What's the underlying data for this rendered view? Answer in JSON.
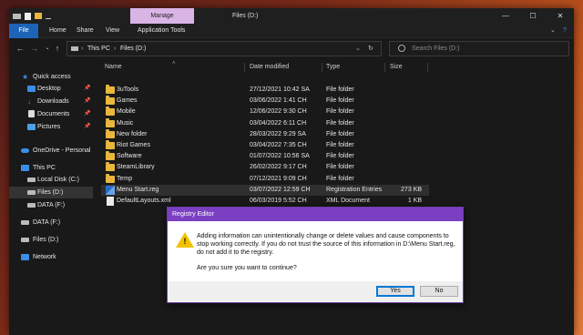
{
  "window": {
    "title": "Files (D:)",
    "manage_tab": "Manage",
    "controls": {
      "minimize": "—",
      "maximize": "☐",
      "close": "✕"
    }
  },
  "ribbon": {
    "tabs": [
      "File",
      "Home",
      "Share",
      "View",
      "Application Tools"
    ]
  },
  "address": {
    "path": [
      "This PC",
      "Files (D:)"
    ],
    "separator": "›",
    "search_placeholder": "Search Files (D:)"
  },
  "nav": {
    "items": [
      {
        "label": "Quick access",
        "icon": "star-icon",
        "pinned": false
      },
      {
        "label": "Desktop",
        "icon": "desktop-icon",
        "pinned": true
      },
      {
        "label": "Downloads",
        "icon": "download-icon",
        "pinned": true
      },
      {
        "label": "Documents",
        "icon": "documents-icon",
        "pinned": true
      },
      {
        "label": "Pictures",
        "icon": "pictures-icon",
        "pinned": true
      },
      {
        "label": "OneDrive - Personal",
        "icon": "cloud-icon",
        "pinned": false
      },
      {
        "label": "This PC",
        "icon": "computer-icon",
        "pinned": false
      },
      {
        "label": "Local Disk (C:)",
        "icon": "drive-icon",
        "pinned": false
      },
      {
        "label": "Files (D:)",
        "icon": "drive-icon",
        "pinned": false
      },
      {
        "label": "DATA (F:)",
        "icon": "drive-icon",
        "pinned": false
      },
      {
        "label": "DATA (F:)",
        "icon": "drive-icon",
        "pinned": false
      },
      {
        "label": "Files (D:)",
        "icon": "drive-icon",
        "pinned": false
      },
      {
        "label": "Network",
        "icon": "network-icon",
        "pinned": false
      }
    ]
  },
  "list": {
    "columns": [
      "Name",
      "Date modified",
      "Type",
      "Size"
    ],
    "rows": [
      {
        "name": "3uTools",
        "date": "27/12/2021 10:42 SA",
        "type": "File folder",
        "size": "",
        "icon": "folder"
      },
      {
        "name": "Games",
        "date": "03/06/2022 1:41 CH",
        "type": "File folder",
        "size": "",
        "icon": "folder"
      },
      {
        "name": "Mobile",
        "date": "12/06/2022 9:30 CH",
        "type": "File folder",
        "size": "",
        "icon": "folder"
      },
      {
        "name": "Music",
        "date": "03/04/2022 6:11 CH",
        "type": "File folder",
        "size": "",
        "icon": "folder"
      },
      {
        "name": "New folder",
        "date": "28/03/2022 9:29 SA",
        "type": "File folder",
        "size": "",
        "icon": "folder"
      },
      {
        "name": "Riot Games",
        "date": "03/04/2022 7:35 CH",
        "type": "File folder",
        "size": "",
        "icon": "folder"
      },
      {
        "name": "Software",
        "date": "01/07/2022 10:56 SA",
        "type": "File folder",
        "size": "",
        "icon": "folder"
      },
      {
        "name": "SteamLibrary",
        "date": "26/02/2022 9:17 CH",
        "type": "File folder",
        "size": "",
        "icon": "folder"
      },
      {
        "name": "Temp",
        "date": "07/12/2021 9:09 CH",
        "type": "File folder",
        "size": "",
        "icon": "folder"
      },
      {
        "name": "Menu Start.reg",
        "date": "03/07/2022 12:59 CH",
        "type": "Registration Entries",
        "size": "273 KB",
        "icon": "reg"
      },
      {
        "name": "DefaultLayouts.xml",
        "date": "06/03/2019 5:52 CH",
        "type": "XML Document",
        "size": "1 KB",
        "icon": "file"
      }
    ]
  },
  "dialog": {
    "title": "Registry Editor",
    "message": "Adding information can unintentionally change or delete values and cause components to stop working correctly. If you do not trust the source of this information in D:\\Menu Start.reg, do not add it to the registry.",
    "question": "Are you sure you want to continue?",
    "yes_label": "Yes",
    "no_label": "No",
    "warning_mark": "!"
  },
  "colors": {
    "accent": "#1c64b8",
    "dialog_title": "#7b3fc2",
    "folder": "#e8b73c"
  }
}
